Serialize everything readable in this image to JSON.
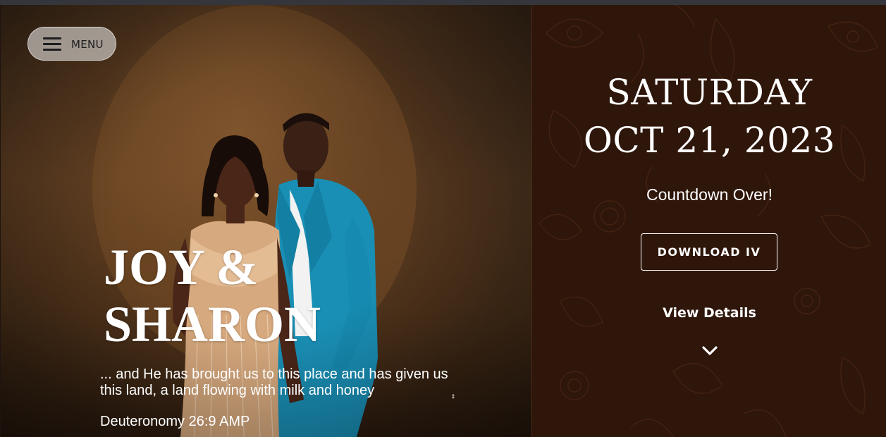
{
  "hero": {
    "menu_label": "MENU",
    "couple_name_line1": "JOY &",
    "couple_name_line2": "SHARON",
    "verse": "... and He has brought us to this place and has given us this land, a land flowing with milk and honey",
    "verse_reference": "Deuteronomy 26:9 AMP",
    "tiny_mark": "‡"
  },
  "panel": {
    "day": "SATURDAY",
    "date": "OCT 21, 2023",
    "countdown_status": "Countdown Over!",
    "download_label": "DOWNLOAD IV",
    "details_label": "View Details"
  },
  "icons": {
    "menu": "hamburger-icon",
    "scroll": "chevron-down-icon"
  },
  "colors": {
    "panel_background": "#2f160a",
    "text": "#ffffff",
    "menu_pill": "#c8c3be"
  }
}
